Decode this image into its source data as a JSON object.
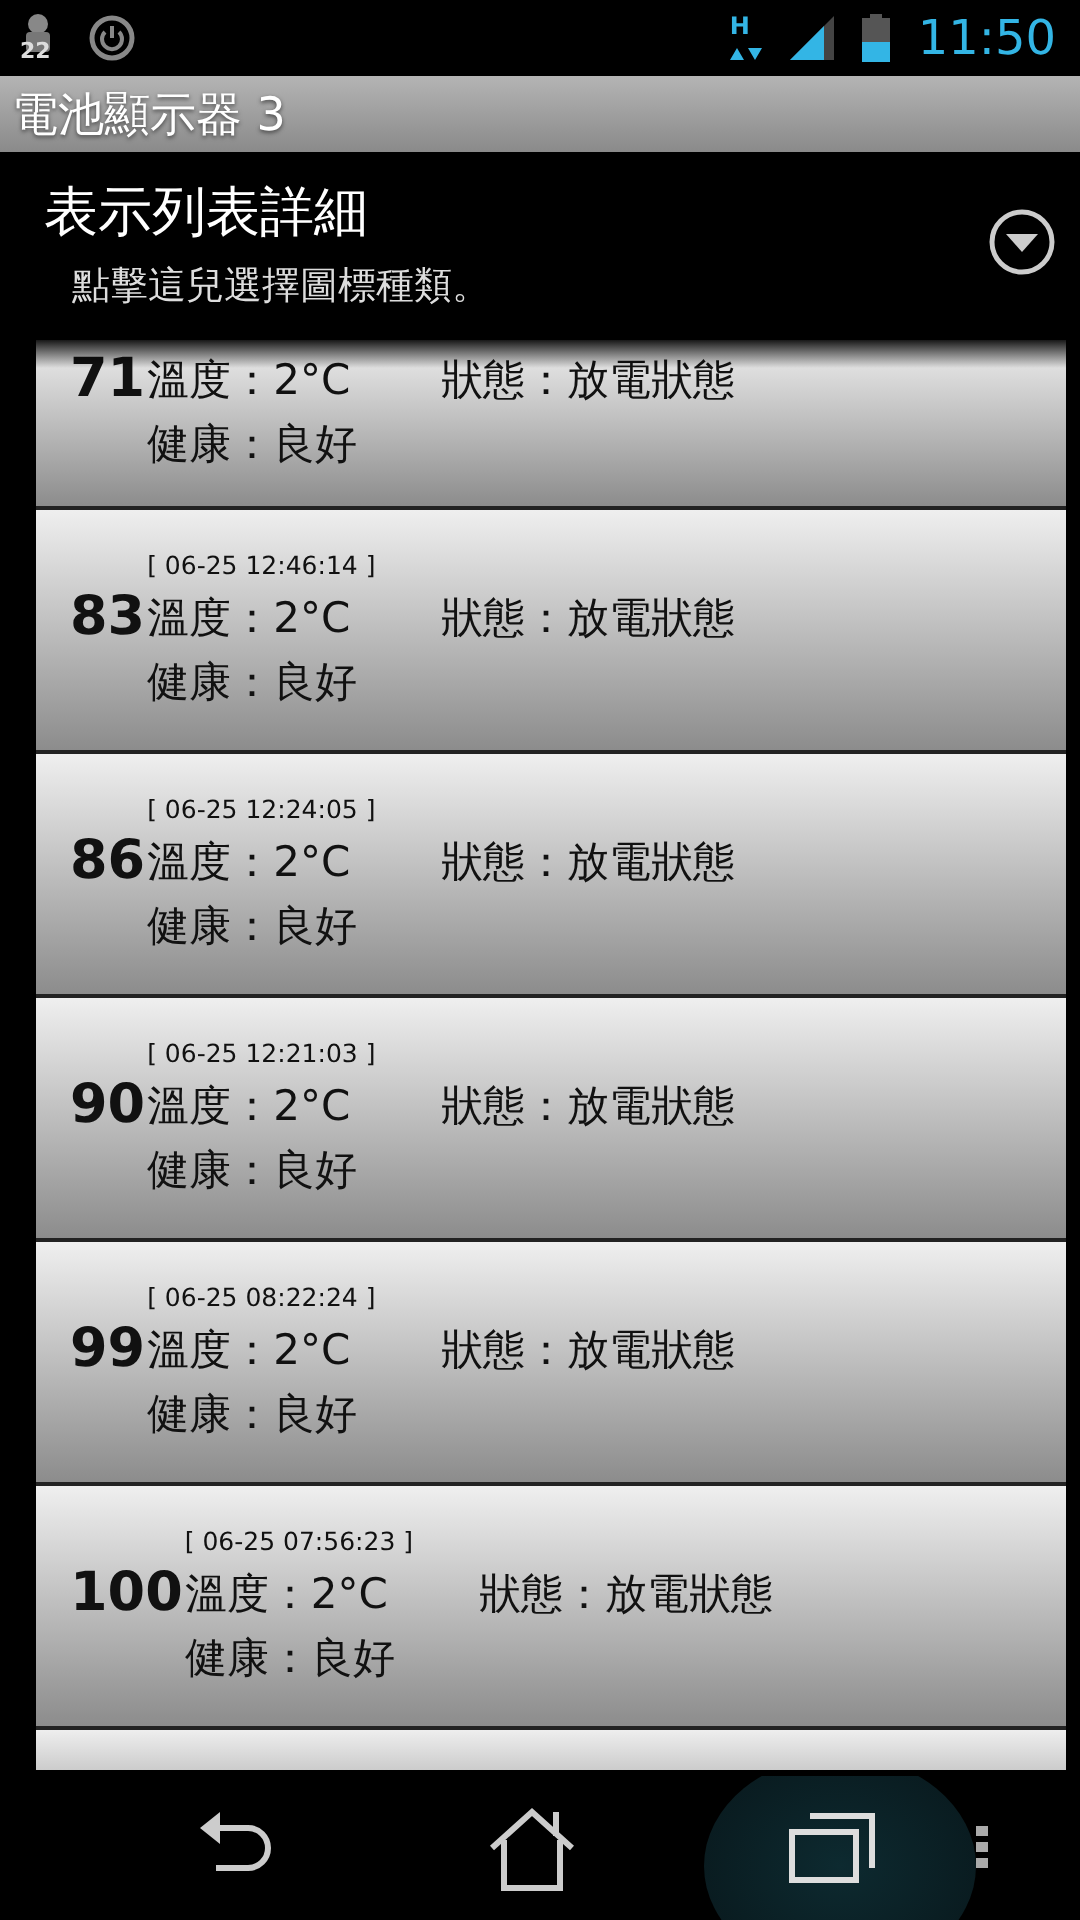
{
  "status_bar": {
    "notification_count": "22",
    "network": "H",
    "time": "11:50"
  },
  "app_title": "電池顯示器 3",
  "header": {
    "title": "表示列表詳細",
    "subtitle": "點擊這兒選擇圖標種類。"
  },
  "records": [
    {
      "percent": "71",
      "temperature": "溫度：2°C",
      "status": "狀態：放電狀態",
      "health": "健康：良好"
    },
    {
      "timestamp": "[ 06-25 12:46:14 ]",
      "percent": "83",
      "temperature": "溫度：2°C",
      "status": "狀態：放電狀態",
      "health": "健康：良好"
    },
    {
      "timestamp": "[ 06-25 12:24:05 ]",
      "percent": "86",
      "temperature": "溫度：2°C",
      "status": "狀態：放電狀態",
      "health": "健康：良好"
    },
    {
      "timestamp": "[ 06-25 12:21:03 ]",
      "percent": "90",
      "temperature": "溫度：2°C",
      "status": "狀態：放電狀態",
      "health": "健康：良好"
    },
    {
      "timestamp": "[ 06-25 08:22:24 ]",
      "percent": "99",
      "temperature": "溫度：2°C",
      "status": "狀態：放電狀態",
      "health": "健康：良好"
    },
    {
      "timestamp": "[ 06-25 07:56:23 ]",
      "percent": "100",
      "temperature": "溫度：2°C",
      "status": "狀態：放電狀態",
      "health": "健康：良好"
    }
  ]
}
